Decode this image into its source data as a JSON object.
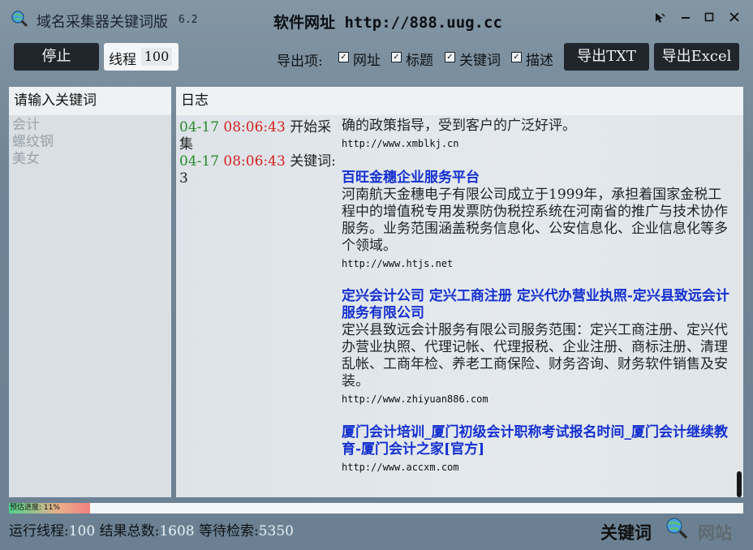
{
  "window": {
    "title": "域名采集器关键词版",
    "version": "6.2",
    "site": "软件网址 http://888.uug.cc"
  },
  "toolbar": {
    "stop_label": "停止",
    "thread_label": "线程",
    "thread_value": "100",
    "export_label": "导出项:",
    "checkboxes": [
      {
        "label": "网址",
        "checked": true
      },
      {
        "label": "标题",
        "checked": true
      },
      {
        "label": "关键词",
        "checked": true
      },
      {
        "label": "描述",
        "checked": true
      }
    ],
    "export_txt_label": "导出TXT",
    "export_excel_label": "导出Excel"
  },
  "keywords_panel": {
    "header": "请输入关键词",
    "items": [
      "会计",
      "螺纹钢",
      "美女"
    ]
  },
  "log_panel": {
    "header": "日志",
    "entries": [
      {
        "date": "04-17",
        "time": "08:06:43",
        "text": "开始采集"
      },
      {
        "date": "04-17",
        "time": "08:06:43",
        "text": "关键词: 3"
      }
    ]
  },
  "results": {
    "partial_top_desc": "确的政策指导，受到客户的广泛好评。",
    "partial_top_url": "http://www.xmblkj.cn",
    "items": [
      {
        "title": "百旺金穗企业服务平台",
        "desc": "河南航天金穗电子有限公司成立于1999年，承担着国家金税工程中的增值税专用发票防伪税控系统在河南省的推广与技术协作服务。业务范围涵盖税务信息化、公安信息化、企业信息化等多个领域。",
        "url": "http://www.htjs.net"
      },
      {
        "title": "定兴会计公司 定兴工商注册 定兴代办营业执照-定兴县致远会计服务有限公司",
        "desc": "定兴县致远会计服务有限公司服务范围：定兴工商注册、定兴代办营业执照、代理记帐、代理报税、企业注册、商标注册、清理乱帐、工商年检、养老工商保险、财务咨询、财务软件销售及安装。",
        "url": "http://www.zhiyuan886.com"
      },
      {
        "title": "厦门会计培训_厦门初级会计职称考试报名时间_厦门会计继续教育-厦门会计之家[官方]",
        "desc": "",
        "url": "http://www.accxm.com"
      }
    ]
  },
  "progress": {
    "label": "预估进度: 11%",
    "percent": 11
  },
  "status": {
    "threads_label": "运行线程:",
    "threads_value": "100",
    "total_label": "结果总数:",
    "total_value": "1608",
    "pending_label": "等待检索:",
    "pending_value": "5350"
  },
  "brand": {
    "keyword_text": "关键词",
    "site_text": "网站"
  }
}
